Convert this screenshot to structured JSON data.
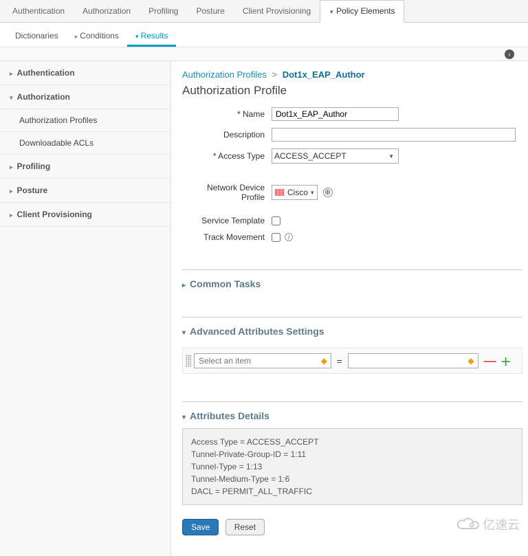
{
  "top_tabs": {
    "items": [
      "Authentication",
      "Authorization",
      "Profiling",
      "Posture",
      "Client Provisioning",
      "Policy Elements"
    ],
    "active": 5
  },
  "sub_tabs": {
    "items": [
      "Dictionaries",
      "Conditions",
      "Results"
    ],
    "active": 2
  },
  "sidebar": {
    "items": [
      {
        "label": "Authentication",
        "expanded": false
      },
      {
        "label": "Authorization",
        "expanded": true,
        "children": [
          "Authorization Profiles",
          "Downloadable ACLs"
        ]
      },
      {
        "label": "Profiling",
        "expanded": false
      },
      {
        "label": "Posture",
        "expanded": false
      },
      {
        "label": "Client Provisioning",
        "expanded": false
      }
    ]
  },
  "breadcrumb": {
    "parent": "Authorization Profiles",
    "current": "Dot1x_EAP_Author"
  },
  "page_title": "Authorization Profile",
  "form": {
    "name_label": "* Name",
    "name_value": "Dot1x_EAP_Author",
    "desc_label": "Description",
    "desc_value": "",
    "access_type_label": "* Access Type",
    "access_type_value": "ACCESS_ACCEPT",
    "ndp_label": "Network Device Profile",
    "ndp_value": "Cisco",
    "service_template_label": "Service Template",
    "track_movement_label": "Track Movement"
  },
  "sections": {
    "common_tasks": "Common Tasks",
    "advanced": "Advanced Attributes Settings",
    "details": "Attributes Details"
  },
  "attr_row": {
    "placeholder": "Select an item"
  },
  "details_text": {
    "l1": "Access Type = ACCESS_ACCEPT",
    "l2": "Tunnel-Private-Group-ID = 1:11",
    "l3": "Tunnel-Type = 1:13",
    "l4": "Tunnel-Medium-Type = 1:6",
    "l5": "DACL = PERMIT_ALL_TRAFFIC"
  },
  "buttons": {
    "save": "Save",
    "reset": "Reset"
  },
  "watermark": "亿速云"
}
